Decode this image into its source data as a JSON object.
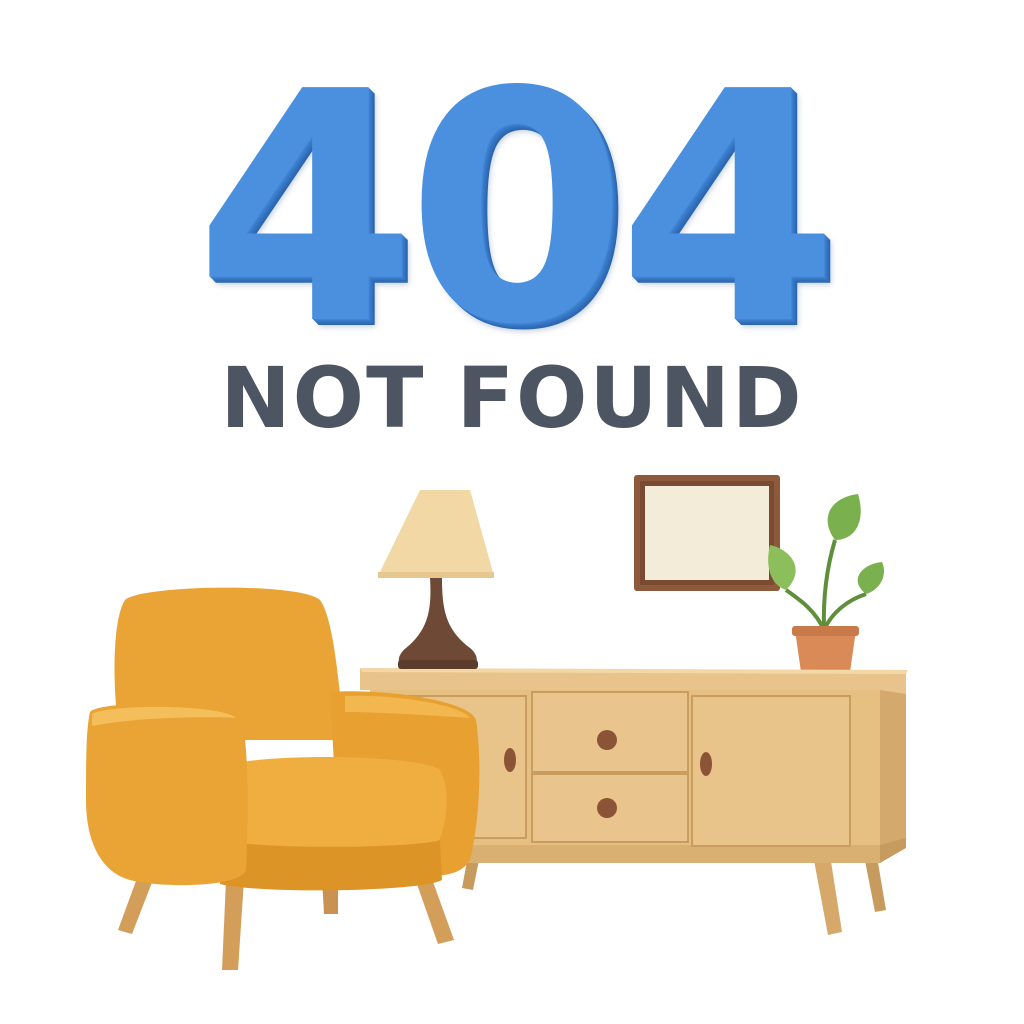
{
  "error": {
    "code": "404",
    "message": "NOT FOUND"
  },
  "colors": {
    "code_blue": "#4a90df",
    "message_gray": "#4d5563",
    "chair_mustard": "#eaa335",
    "wood_light": "#e6bf82",
    "lamp_shade": "#f2d8a4",
    "lamp_base": "#6e4a36",
    "plant_green": "#7bb04e",
    "pot_terracotta": "#d98a57"
  },
  "illustration": {
    "items": [
      "armchair",
      "sideboard",
      "table-lamp",
      "picture-frame",
      "potted-plant"
    ]
  }
}
